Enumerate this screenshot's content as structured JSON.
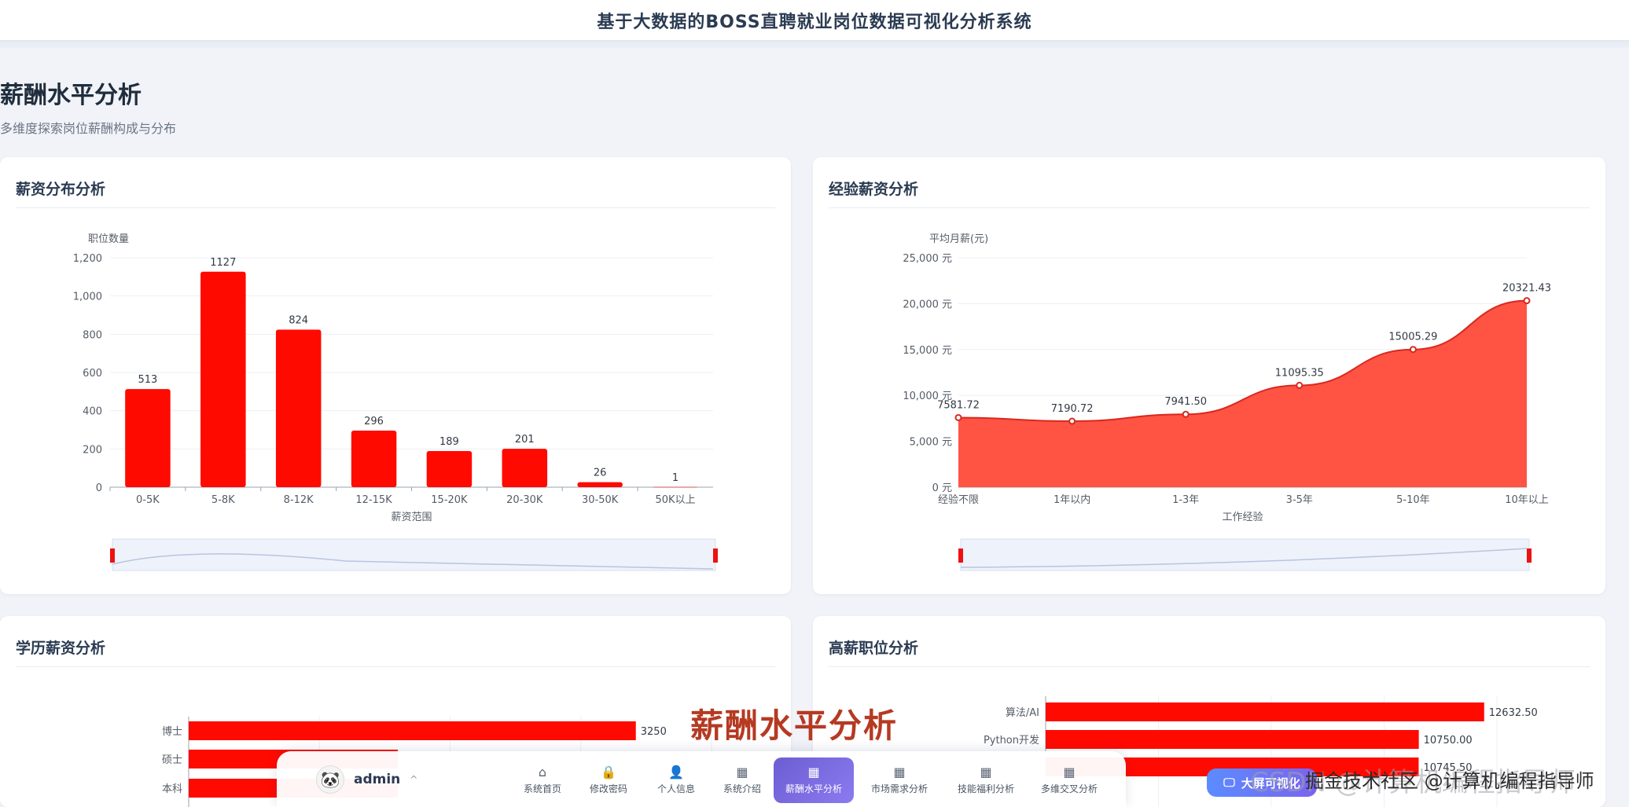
{
  "app": {
    "title": "基于大数据的BOSS直聘就业岗位数据可视化分析系统"
  },
  "page": {
    "title": "薪酬水平分析",
    "subtitle": "多维度探索岗位薪酬构成与分布"
  },
  "cards": {
    "salary_dist": {
      "title": "薪资分布分析"
    },
    "exp_salary": {
      "title": "经验薪资分析"
    },
    "edu_salary": {
      "title": "学历薪资分析"
    },
    "high_pay": {
      "title": "高薪职位分析"
    }
  },
  "chart_data": [
    {
      "type": "bar",
      "title": "薪资分布分析",
      "xlabel": "薪资范围",
      "ylabel": "职位数量",
      "categories": [
        "0-5K",
        "5-8K",
        "8-12K",
        "12-15K",
        "15-20K",
        "20-30K",
        "30-50K",
        "50K以上"
      ],
      "values": [
        513,
        1127,
        824,
        296,
        189,
        201,
        26,
        1
      ],
      "ylim": [
        0,
        1200
      ],
      "yticks": [
        "0",
        "200",
        "400",
        "600",
        "800",
        "1,000",
        "1,200"
      ],
      "color": "#ff0a00",
      "grid": true
    },
    {
      "type": "area",
      "title": "经验薪资分析",
      "xlabel": "工作经验",
      "ylabel": "平均月薪(元)",
      "categories": [
        "经验不限",
        "1年以内",
        "1-3年",
        "3-5年",
        "5-10年",
        "10年以上"
      ],
      "values": [
        7581.72,
        7190.72,
        7941.5,
        11095.35,
        15005.29,
        20321.43
      ],
      "value_labels": [
        "7581.72",
        "7190.72",
        "7941.50",
        "11095.35",
        "15005.29",
        "20321.43"
      ],
      "ylim": [
        0,
        25000
      ],
      "yticks": [
        "0 元",
        "5,000 元",
        "10,000 元",
        "15,000 元",
        "20,000 元",
        "25,000 元"
      ],
      "color": "#ff4a3a",
      "grid": true
    },
    {
      "type": "bar",
      "orientation": "horizontal",
      "title": "学历薪资分析",
      "categories": [
        "博士",
        "硕士",
        "本科"
      ],
      "values": [
        3250,
        null,
        null
      ],
      "value_labels": [
        "3250",
        "",
        ""
      ],
      "color": "#ff0a00"
    },
    {
      "type": "bar",
      "orientation": "horizontal",
      "title": "高薪职位分析",
      "categories": [
        "算法/AI",
        "Python开发",
        ""
      ],
      "values": [
        12632.5,
        10750.0,
        10745.5
      ],
      "value_labels": [
        "12632.50",
        "10750.00",
        "10745.50"
      ],
      "color": "#ff0a00"
    }
  ],
  "overlay": {
    "caption": "薪酬水平分析",
    "watermark": "CSDN @计算机编程指导师",
    "watermark2": "掘金技术社区 @计算机编程指导师"
  },
  "dock": {
    "user": {
      "name": "admin",
      "avatar_icon": "panda-icon"
    },
    "nav": [
      {
        "label": "系统首页",
        "icon": "home-icon"
      },
      {
        "label": "修改密码",
        "icon": "lock-icon"
      },
      {
        "label": "个人信息",
        "icon": "user-icon"
      },
      {
        "label": "系统介绍",
        "icon": "grid-icon"
      },
      {
        "label": "薪酬水平分析",
        "icon": "grid-icon",
        "active": true
      },
      {
        "label": "市场需求分析",
        "icon": "grid-icon"
      },
      {
        "label": "技能福利分析",
        "icon": "grid-icon"
      },
      {
        "label": "多维交叉分析",
        "icon": "grid-icon"
      }
    ],
    "big_screen_label": "大屏可视化"
  }
}
